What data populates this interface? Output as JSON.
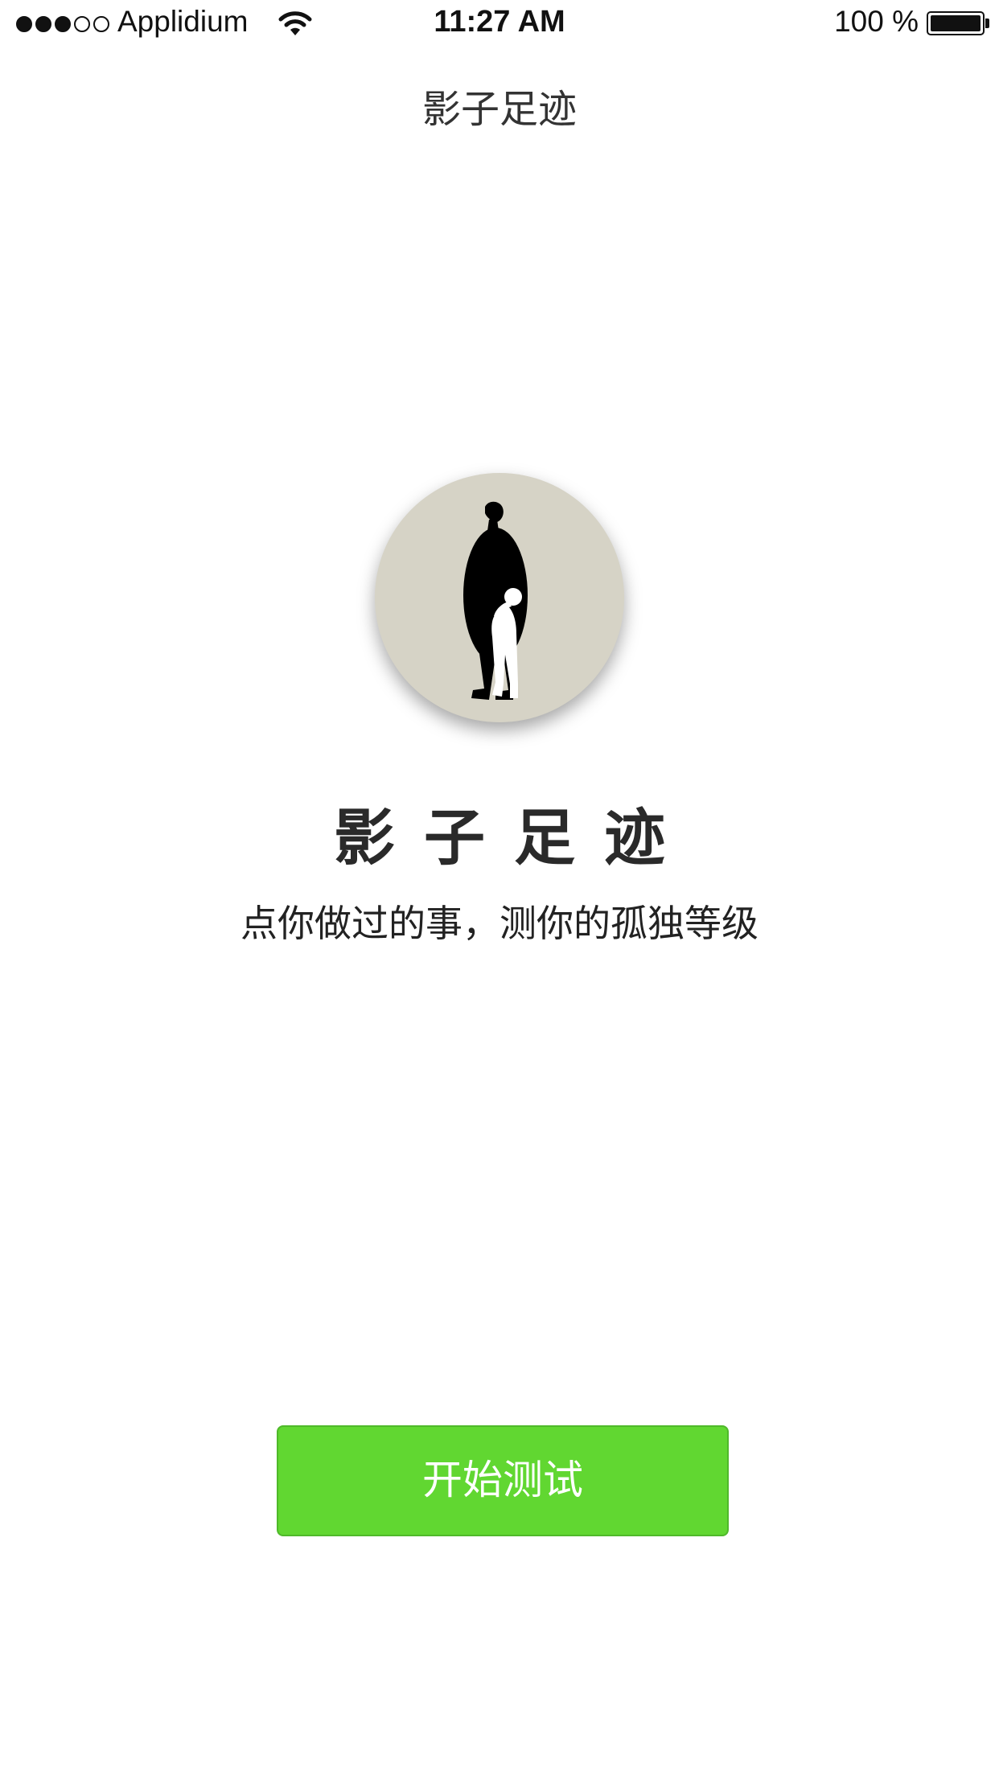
{
  "status_bar": {
    "carrier": "Applidium",
    "time": "11:27 AM",
    "battery": "100 %",
    "signal_bars": 3,
    "signal_total": 5
  },
  "nav": {
    "title": "影子足迹"
  },
  "hero": {
    "title": "影子足迹",
    "subtitle": "点你做过的事，测你的孤独等级",
    "logo_background": "#d6d3c6"
  },
  "actions": {
    "start_label": "开始测试",
    "start_color": "#61d731"
  }
}
